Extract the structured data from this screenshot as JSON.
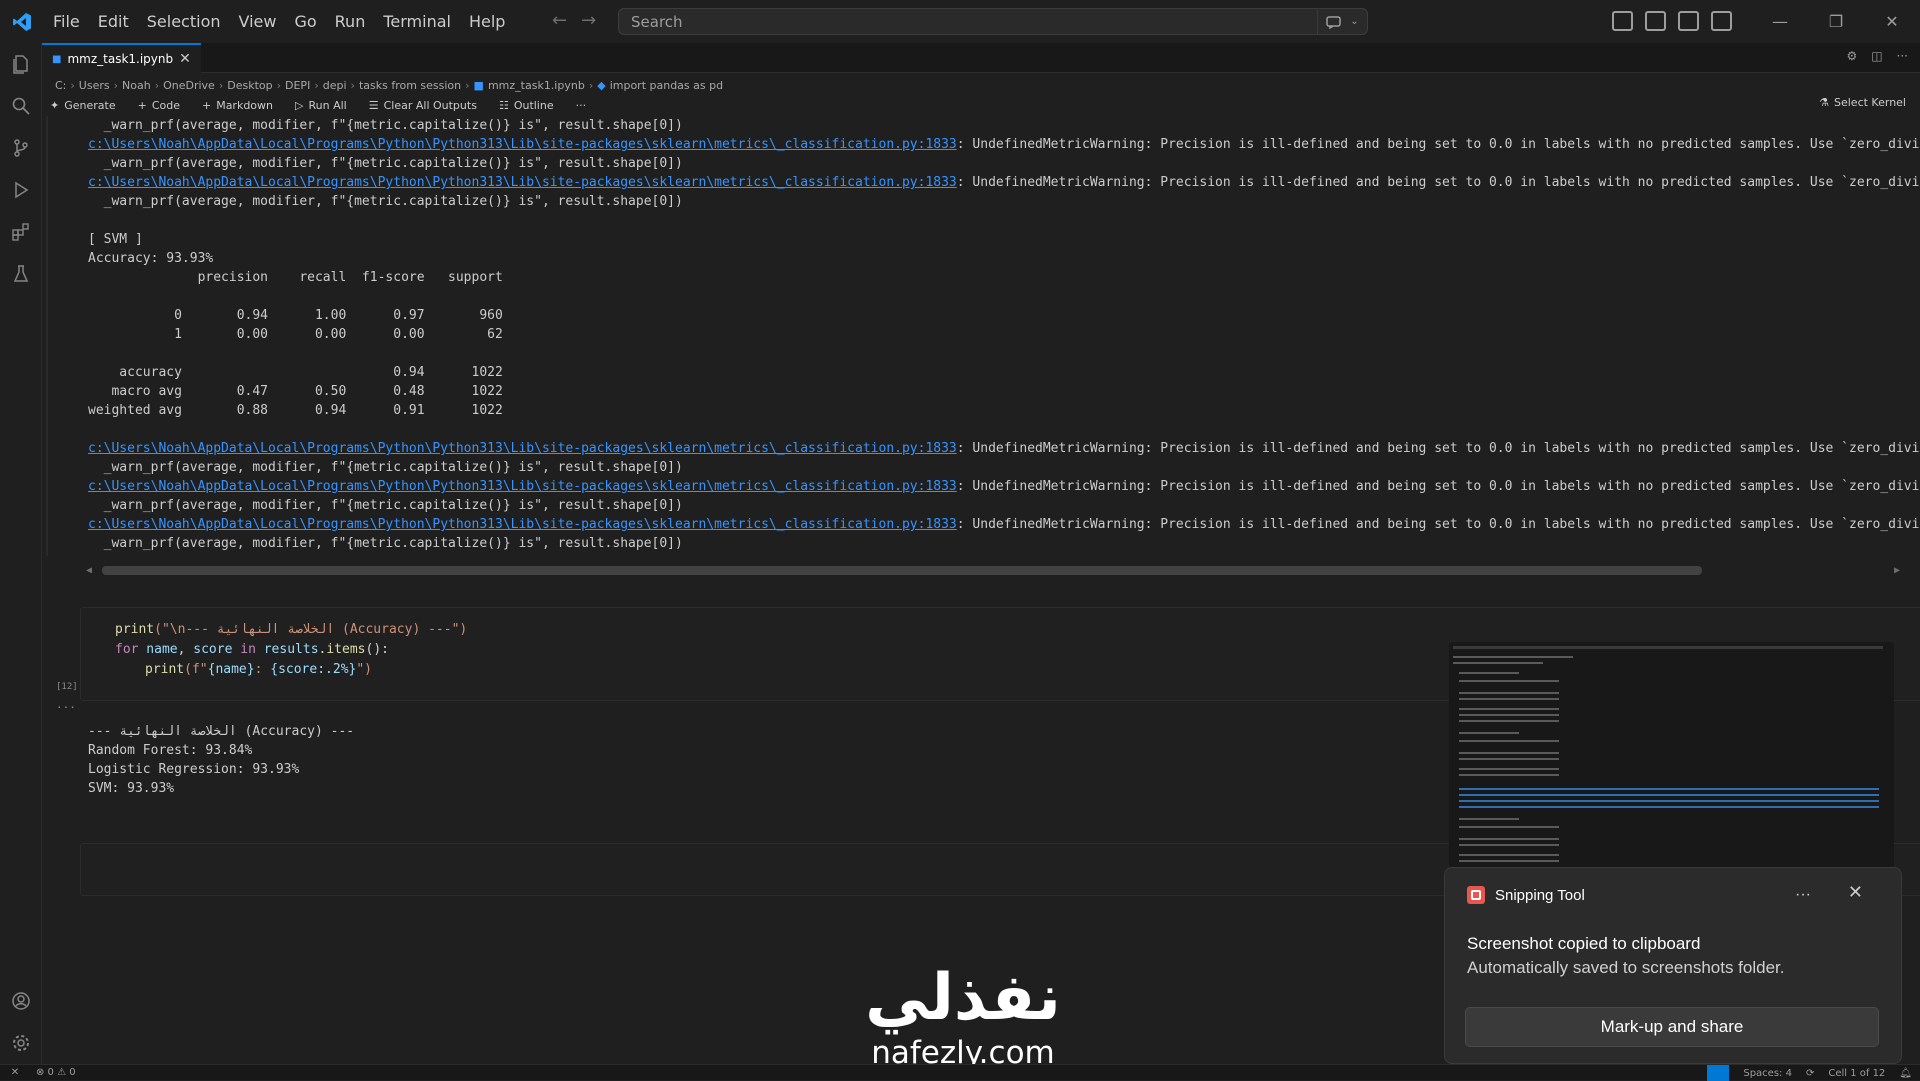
{
  "menu": [
    "File",
    "Edit",
    "Selection",
    "View",
    "Go",
    "Run",
    "Terminal",
    "Help"
  ],
  "search": {
    "placeholder": "Search"
  },
  "tab": {
    "label": "mmz_task1.ipynb"
  },
  "breadcrumb": [
    "C:",
    "Users",
    "Noah",
    "OneDrive",
    "Desktop",
    "DEPI",
    "depi",
    "tasks from session",
    "mmz_task1.ipynb",
    "import pandas as pd"
  ],
  "toolbar": {
    "generate": "Generate",
    "code": "Code",
    "markdown": "Markdown",
    "run_all": "Run All",
    "clear": "Clear All Outputs",
    "outline": "Outline",
    "more": "···",
    "kernel": "Select Kernel"
  },
  "output": {
    "warn_line": "  _warn_prf(average, modifier, f\"{metric.capitalize()} is\", result.shape[0])",
    "link": "c:\\Users\\Noah\\AppData\\Local\\Programs\\Python\\Python313\\Lib\\site-packages\\sklearn\\metrics\\_classification.py:1833",
    "warning": ": UndefinedMetricWarning: Precision is ill-defined and being set to 0.0 in labels with no predicted samples. Use `zero_division",
    "svm_header": "[ SVM ]",
    "svm_accuracy": "Accuracy: 93.93%",
    "report_header": "              precision    recall  f1-score   support",
    "report_row_0": "           0       0.94      1.00      0.97       960",
    "report_row_1": "           1       0.00      0.00      0.00        62",
    "report_accuracy": "    accuracy                           0.94      1022",
    "report_macro": "   macro avg       0.47      0.50      0.48      1022",
    "report_weighted": "weighted avg       0.88      0.94      0.91      1022"
  },
  "code_cell": {
    "line1_fn": "print",
    "line1_str": "(\"\\n--- الخلاصة النهائية (Accuracy) ---\")",
    "line2_for": "for",
    "line2_name": " name",
    "line2_comma": ", ",
    "line2_score": "score",
    "line2_in": " in ",
    "line2_results": "results",
    "line2_items": ".items",
    "line2_end": "():",
    "line3_fn": "print",
    "line3_str_a": "(f\"",
    "line3_name": "{name}",
    "line3_mid": ": ",
    "line3_score": "{score:.2%}",
    "line3_end": "\")",
    "exec_count": "[12]"
  },
  "code_output": {
    "line1": "--- الخلاصة النهائية (Accuracy) ---",
    "line2": "Random Forest: 93.84%",
    "line3": "Logistic Regression: 93.93%",
    "line4": "SVM: 93.93%"
  },
  "toast": {
    "app": "Snipping Tool",
    "message": "Screenshot copied to clipboard",
    "sub": "Automatically saved to screenshots folder.",
    "button": "Mark-up and share",
    "more": "···",
    "close": "✕"
  },
  "watermark": {
    "arabic": "نفذلي",
    "latin": "nafezly.com"
  },
  "status": {
    "problems": "⊗ 0 ⚠ 0",
    "spaces": "Spaces: 4",
    "cell": "Cell 1 of 12"
  },
  "colors": {
    "accent": "#0078d4",
    "link": "#3794ff",
    "toast_bg": "#2b2b2b"
  }
}
